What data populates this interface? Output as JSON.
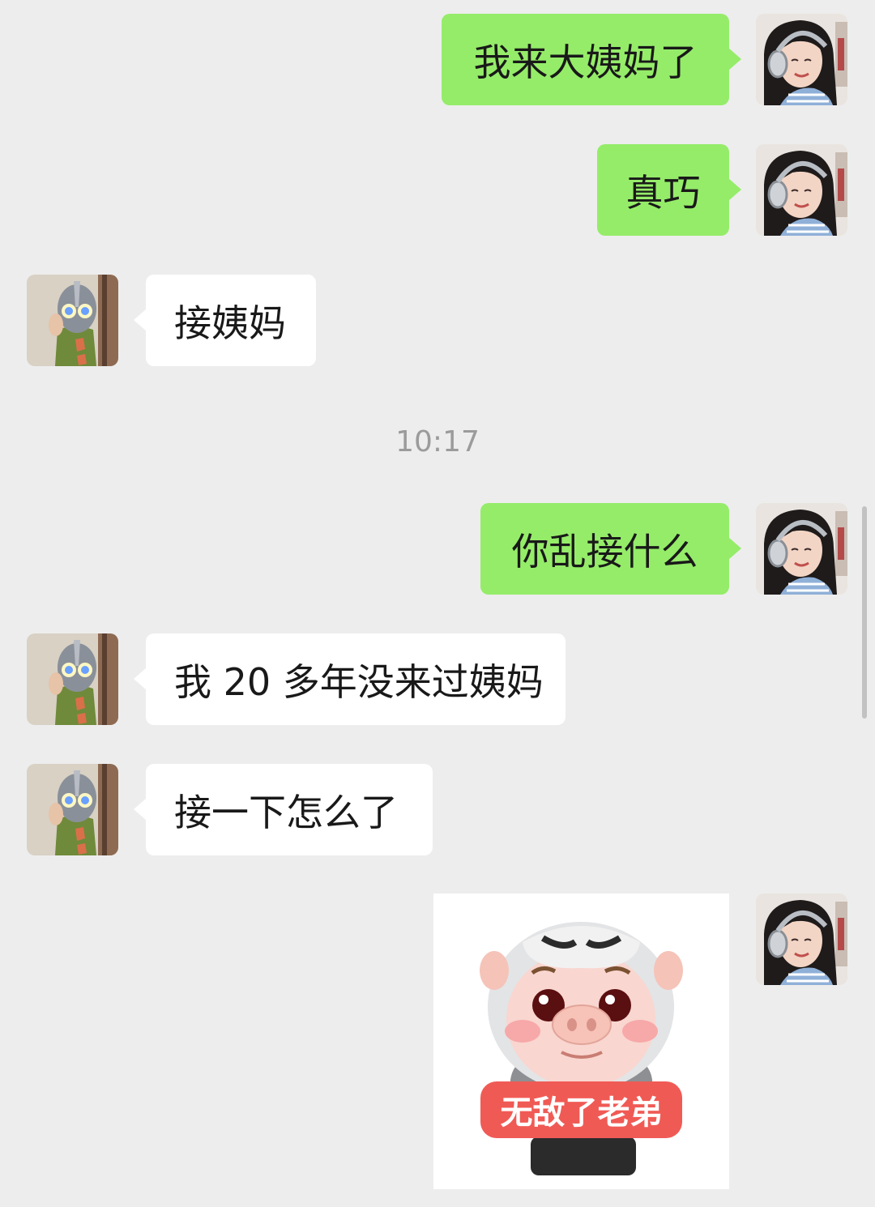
{
  "colors": {
    "background": "#ededed",
    "outgoing_bubble": "#95ec69",
    "incoming_bubble": "#ffffff",
    "timestamp_text": "#9b9b9b",
    "sticker_caption_bg": "#f05a55"
  },
  "avatars": {
    "self": "girl-with-headphones-avatar",
    "other": "masked-hero-avatar"
  },
  "messages": [
    {
      "side": "out",
      "text": "我来大姨妈了"
    },
    {
      "side": "out",
      "text": "真巧"
    },
    {
      "side": "in",
      "text": "接姨妈"
    },
    {
      "side": "out",
      "text": "你乱接什么"
    },
    {
      "side": "in",
      "text": "我 20 多年没来过姨妈"
    },
    {
      "side": "in",
      "text": "接一下怎么了"
    },
    {
      "side": "out",
      "type": "sticker",
      "sticker": "cartoon-pig-sticker",
      "caption": "无敌了老弟"
    }
  ],
  "timestamp": "10:17"
}
